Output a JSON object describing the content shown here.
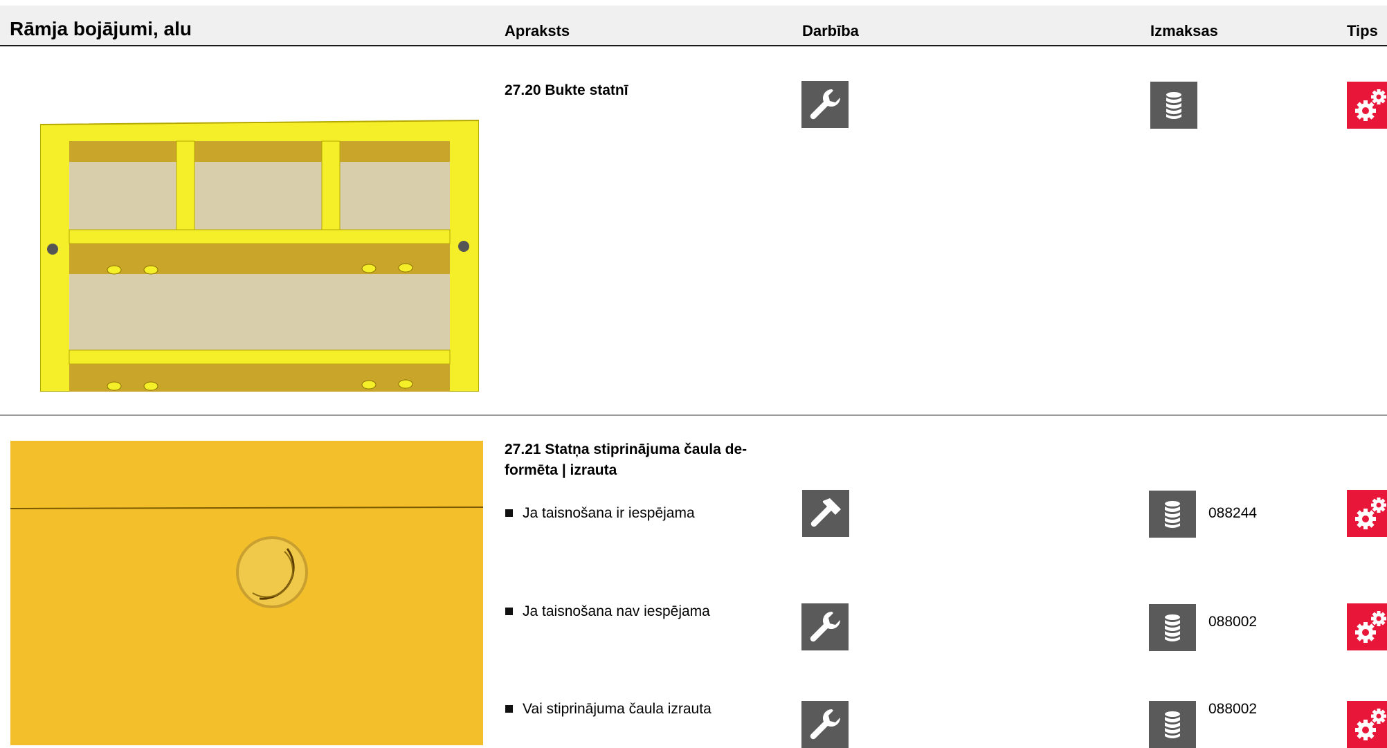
{
  "header": {
    "title": "Rāmja bojājumi, alu",
    "col_description": "Apraksts",
    "col_action": "Darbība",
    "col_cost": "Izmaksas",
    "col_tips": "Tips"
  },
  "items": [
    {
      "title": "27.20 Bukte statnī",
      "image": "yellow-frame-drawing",
      "rows": [
        {
          "text": "",
          "action_icon": "wrench-icon",
          "cost_icon": "coin-stack-icon",
          "code": "",
          "tips_icon": "gears-icon"
        }
      ]
    },
    {
      "title_line1": "27.21 Statņa stiprinājuma čaula de-",
      "title_line2": "formēta | izrauta",
      "image": "yellow-panel-hole",
      "rows": [
        {
          "text": "Ja taisnošana ir iespējama",
          "action_icon": "hammer-icon",
          "cost_icon": "coin-stack-icon",
          "code": "088244",
          "tips_icon": "gears-icon"
        },
        {
          "text": "Ja taisnošana nav iespējama",
          "action_icon": "wrench-icon",
          "cost_icon": "coin-stack-icon",
          "code": "088002",
          "tips_icon": "gears-icon"
        },
        {
          "text": "Vai stiprinājuma čaula izrauta",
          "action_icon": "wrench-icon",
          "cost_icon": "coin-stack-icon",
          "code": "088002",
          "tips_icon": "gears-icon"
        }
      ]
    }
  ],
  "colors": {
    "header_bg": "#f0f0f0",
    "icon_gray": "#5a5a5a",
    "tips_red": "#e8173a",
    "frame_yellow": "#f5ef2a",
    "panel_yellow": "#f3bf2a"
  }
}
